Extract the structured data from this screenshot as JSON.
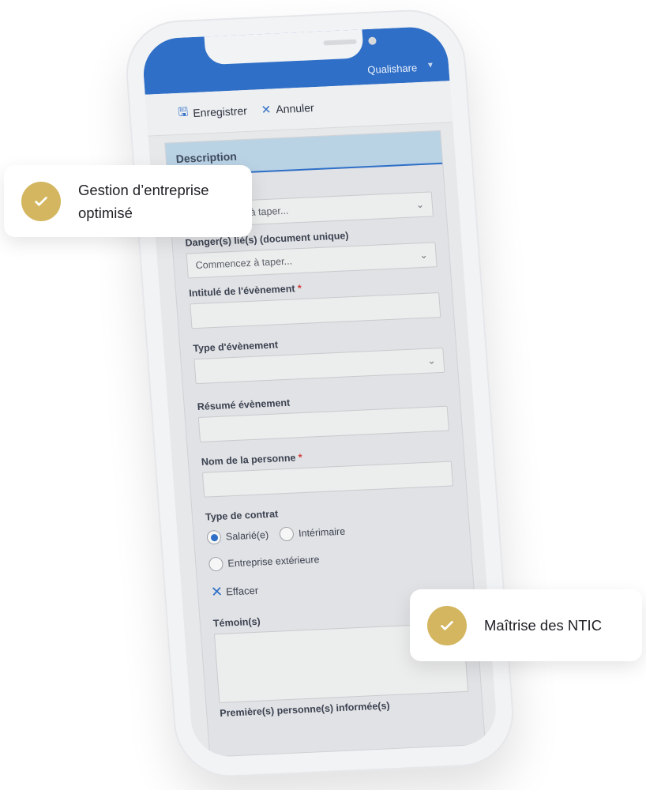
{
  "app": {
    "brand": "Qualishare"
  },
  "toolbar": {
    "save_label": "Enregistrer",
    "cancel_label": "Annuler"
  },
  "form": {
    "section_title": "Description",
    "dropdown1_placeholder": "Commencez à taper...",
    "dangers_label": "Danger(s) lié(s) (document unique)",
    "dangers_placeholder": "Commencez à taper...",
    "title_label": "Intitulé de l'évènement",
    "event_type_label": "Type d'évènement",
    "summary_label": "Résumé évènement",
    "person_label": "Nom de la personne",
    "contract_label": "Type de contrat",
    "contract_options": [
      "Salarié(e)",
      "Intérimaire",
      "Entreprise extérieure"
    ],
    "contract_selected": "Salarié(e)",
    "clear_label": "Effacer",
    "witness_label": "Témoin(s)",
    "next_label": "Première(s) personne(s) informée(s)"
  },
  "badges": {
    "left": [
      "Gestion d’entreprise",
      "optimisé"
    ],
    "right": "Maîtrise des NTIC"
  },
  "colors": {
    "accent_blue": "#2f6fc7",
    "badge_gold": "#d3b65f",
    "required_red": "#d13b3b"
  }
}
